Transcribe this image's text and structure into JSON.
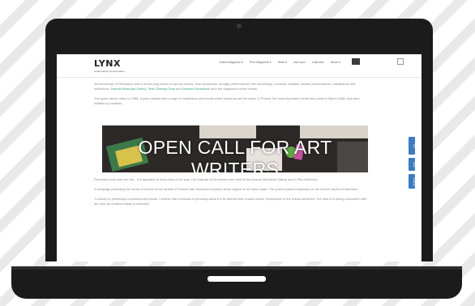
{
  "site": {
    "logo": "LYNX",
    "tagline": "contemporary art and nature"
  },
  "nav": {
    "items": [
      "Online Magazine ▾",
      "Print Magazine ▾",
      "Store ▾",
      "Join Lynx",
      "Calendar",
      "About ▾"
    ]
  },
  "article": {
    "p1_before": "All Workshops of Revolution was a month-long series of various events, from workshops, through performances, film screenings, concerts, debates, theatre performances, installations and exhibitions.",
    "p1_link1": "Arsenal Municipal Gallery",
    "p1_sep1": ",",
    "p1_link2": "Teatr Ósmego Dnia",
    "p1_and": "and",
    "p1_link3": "Estrada Poznańska",
    "p1_after": "were the organisers of the events.",
    "p2": "The quote above refers to 1968, a year marked with a surge of manifestos and revolts which swept across the world. In Poland, the most important events took place in March 1968, and were initiated by students.",
    "banner_title": "OPEN CALL FOR ART WRITERS",
    "p3": "Revolution took over the city – it is apparent at every step of the way. The majority of the events were held at the Arsenal Municipal Gallery and in Plac Wolności.",
    "p4": "A campaign promoting the series of events hit the streets of Poznań with fluorescent posters which appear to be hand-made. The posters placed emphasis on the event's aspect of liberation.",
    "p5": "“Contrary to yesterday's contemporary trends, I believe that revolution is precisely about the lie derived from shared action, irrespective of the results achieved. The idea of a strong connection with the past, as revisited today, is essential.”"
  },
  "share": {
    "buttons": [
      "Like",
      "Share",
      "Facebook"
    ]
  }
}
